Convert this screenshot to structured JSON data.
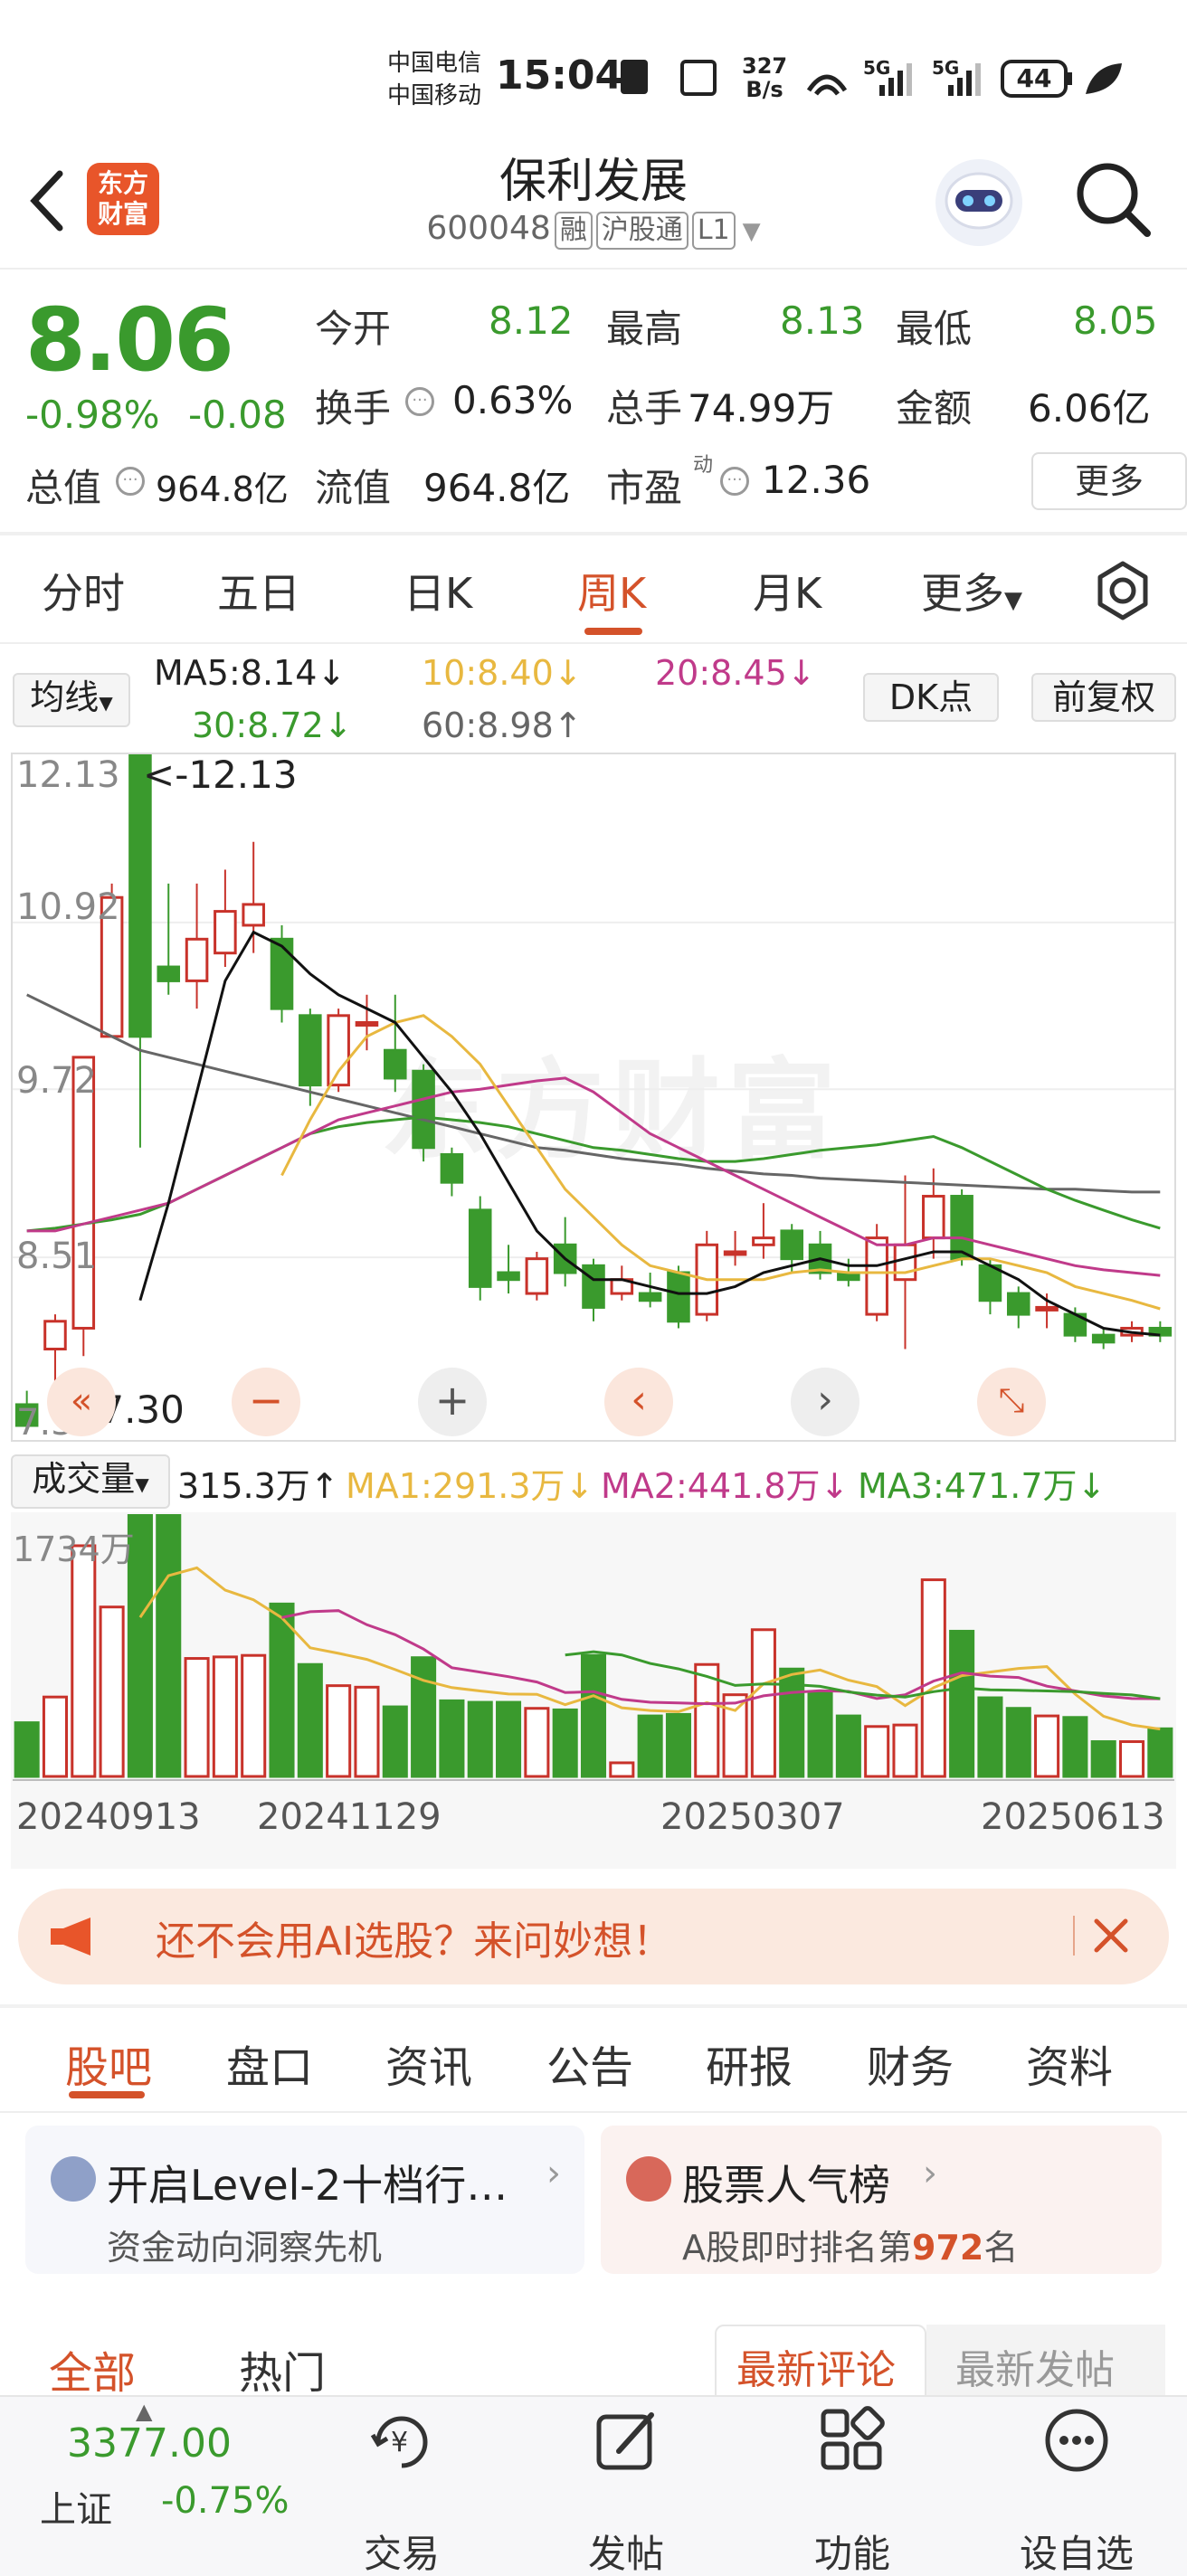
{
  "status_bar": {
    "carrier1": "中国电信",
    "carrier2": "中国移动",
    "time": "15:04",
    "speed_top": "327",
    "speed_bottom": "B/s",
    "battery": "44"
  },
  "header": {
    "back_icon": "chevron-left-icon",
    "logo_line1": "东方",
    "logo_line2": "财富",
    "title": "保利发展",
    "code": "600048",
    "tag1": "融",
    "tag2": "沪股通",
    "tag3": "L1",
    "search_icon": "search-icon"
  },
  "quote": {
    "price": "8.06",
    "change_pct": "-0.98%",
    "change": "-0.08",
    "open_label": "今开",
    "open": "8.12",
    "high_label": "最高",
    "high": "8.13",
    "low_label": "最低",
    "low": "8.05",
    "turnover_label": "换手",
    "turnover": "0.63%",
    "volume_label": "总手",
    "volume": "74.99万",
    "amount_label": "金额",
    "amount": "6.06亿",
    "mktcap_label": "总值",
    "mktcap": "964.8亿",
    "float_label": "流值",
    "float": "964.8亿",
    "pe_label": "市盈",
    "pe_sup": "动",
    "pe": "12.36",
    "more": "更多"
  },
  "period_tabs": [
    "分时",
    "五日",
    "日K",
    "周K",
    "月K",
    "更多"
  ],
  "active_period": "周K",
  "chart": {
    "ma_select": "均线",
    "ma5": "MA5:8.14↓",
    "ma10": "10:8.40↓",
    "ma20": "20:8.45↓",
    "ma30": "30:8.72↓",
    "ma60": "60:8.98↑",
    "dk_button": "DK点",
    "adjust_button": "前复权",
    "y_labels": [
      "12.13",
      "10.92",
      "9.72",
      "8.51",
      "7.30"
    ],
    "max_note": "<-12.13",
    "min_note": "<-7.30",
    "watermark": "东方财富",
    "colors": {
      "up": "#c8322a",
      "down": "#3a9a2d",
      "ma5": "#111111",
      "ma10": "#e8b840",
      "ma20": "#c03a8a",
      "ma30": "#3a9a2d",
      "ma60": "#666666"
    }
  },
  "volume": {
    "select": "成交量",
    "value": "315.3万↑",
    "ma1": "MA1:291.3万↓",
    "ma2": "MA2:441.8万↓",
    "ma3": "MA3:471.7万↓",
    "y_label": "1734万",
    "dates": [
      "20240913",
      "20241129",
      "20250307",
      "20250613"
    ]
  },
  "chart_data": {
    "type": "candlestick",
    "y_range": [
      7.3,
      12.13
    ],
    "period": "weekly",
    "candles": [
      {
        "o": 7.45,
        "c": 7.3,
        "h": 7.55,
        "l": 7.3
      },
      {
        "o": 7.85,
        "c": 8.05,
        "h": 8.1,
        "l": 7.35
      },
      {
        "o": 8.0,
        "c": 9.95,
        "h": 9.95,
        "l": 7.8
      },
      {
        "o": 10.1,
        "c": 11.1,
        "h": 11.2,
        "l": 10.1
      },
      {
        "o": 12.13,
        "c": 10.1,
        "h": 12.13,
        "l": 9.3
      },
      {
        "o": 10.6,
        "c": 10.5,
        "h": 11.2,
        "l": 10.4
      },
      {
        "o": 10.5,
        "c": 10.8,
        "h": 11.2,
        "l": 10.3
      },
      {
        "o": 10.7,
        "c": 11.0,
        "h": 11.3,
        "l": 10.6
      },
      {
        "o": 10.9,
        "c": 11.05,
        "h": 11.5,
        "l": 10.7
      },
      {
        "o": 10.8,
        "c": 10.3,
        "h": 10.9,
        "l": 10.2
      },
      {
        "o": 10.25,
        "c": 9.75,
        "h": 10.3,
        "l": 9.6
      },
      {
        "o": 9.75,
        "c": 10.25,
        "h": 10.3,
        "l": 9.7
      },
      {
        "o": 10.2,
        "c": 10.2,
        "h": 10.4,
        "l": 10.0
      },
      {
        "o": 10.0,
        "c": 9.8,
        "h": 10.4,
        "l": 9.7
      },
      {
        "o": 9.85,
        "c": 9.3,
        "h": 9.9,
        "l": 9.2
      },
      {
        "o": 9.25,
        "c": 9.05,
        "h": 9.3,
        "l": 8.95
      },
      {
        "o": 8.85,
        "c": 8.3,
        "h": 8.95,
        "l": 8.2
      },
      {
        "o": 8.4,
        "c": 8.35,
        "h": 8.6,
        "l": 8.25
      },
      {
        "o": 8.25,
        "c": 8.5,
        "h": 8.55,
        "l": 8.2
      },
      {
        "o": 8.6,
        "c": 8.4,
        "h": 8.8,
        "l": 8.3
      },
      {
        "o": 8.45,
        "c": 8.15,
        "h": 8.5,
        "l": 8.05
      },
      {
        "o": 8.25,
        "c": 8.35,
        "h": 8.45,
        "l": 8.2
      },
      {
        "o": 8.25,
        "c": 8.2,
        "h": 8.4,
        "l": 8.15
      },
      {
        "o": 8.4,
        "c": 8.05,
        "h": 8.45,
        "l": 8.0
      },
      {
        "o": 8.1,
        "c": 8.6,
        "h": 8.7,
        "l": 8.05
      },
      {
        "o": 8.55,
        "c": 8.55,
        "h": 8.7,
        "l": 8.45
      },
      {
        "o": 8.6,
        "c": 8.65,
        "h": 8.9,
        "l": 8.5
      },
      {
        "o": 8.7,
        "c": 8.5,
        "h": 8.75,
        "l": 8.4
      },
      {
        "o": 8.6,
        "c": 8.4,
        "h": 8.7,
        "l": 8.35
      },
      {
        "o": 8.4,
        "c": 8.35,
        "h": 8.5,
        "l": 8.3
      },
      {
        "o": 8.1,
        "c": 8.65,
        "h": 8.75,
        "l": 8.05
      },
      {
        "o": 8.35,
        "c": 8.6,
        "h": 9.1,
        "l": 7.85
      },
      {
        "o": 8.65,
        "c": 8.95,
        "h": 9.15,
        "l": 8.5
      },
      {
        "o": 8.95,
        "c": 8.5,
        "h": 9.0,
        "l": 8.45
      },
      {
        "o": 8.45,
        "c": 8.2,
        "h": 8.5,
        "l": 8.1
      },
      {
        "o": 8.25,
        "c": 8.1,
        "h": 8.3,
        "l": 8.0
      },
      {
        "o": 8.15,
        "c": 8.15,
        "h": 8.25,
        "l": 8.0
      },
      {
        "o": 8.1,
        "c": 7.95,
        "h": 8.15,
        "l": 7.9
      },
      {
        "o": 7.95,
        "c": 7.9,
        "h": 8.0,
        "l": 7.85
      },
      {
        "o": 7.95,
        "c": 8.0,
        "h": 8.05,
        "l": 7.9
      },
      {
        "o": 8.0,
        "c": 7.95,
        "h": 8.05,
        "l": 7.9
      }
    ],
    "ma5": [
      null,
      null,
      null,
      null,
      8.2,
      8.9,
      9.7,
      10.5,
      10.85,
      10.75,
      10.55,
      10.4,
      10.3,
      10.2,
      9.95,
      9.7,
      9.4,
      9.05,
      8.7,
      8.5,
      8.35,
      8.35,
      8.3,
      8.25,
      8.25,
      8.3,
      8.4,
      8.45,
      8.5,
      8.45,
      8.45,
      8.5,
      8.55,
      8.55,
      8.45,
      8.35,
      8.2,
      8.1,
      8.0,
      7.97,
      7.95
    ],
    "ma10": [
      null,
      null,
      null,
      null,
      null,
      null,
      null,
      null,
      null,
      9.1,
      9.5,
      9.85,
      10.1,
      10.2,
      10.25,
      10.1,
      9.9,
      9.6,
      9.3,
      9.0,
      8.8,
      8.6,
      8.45,
      8.4,
      8.35,
      8.35,
      8.35,
      8.4,
      8.42,
      8.4,
      8.4,
      8.4,
      8.45,
      8.5,
      8.5,
      8.45,
      8.4,
      8.3,
      8.25,
      8.2,
      8.14
    ],
    "ma20": [
      8.7,
      8.7,
      8.75,
      8.8,
      8.85,
      8.9,
      9.0,
      9.1,
      9.2,
      9.3,
      9.4,
      9.5,
      9.55,
      9.6,
      9.65,
      9.7,
      9.72,
      9.75,
      9.78,
      9.8,
      9.7,
      9.55,
      9.4,
      9.3,
      9.2,
      9.1,
      9.0,
      8.9,
      8.8,
      8.7,
      8.6,
      8.6,
      8.65,
      8.65,
      8.6,
      8.55,
      8.5,
      8.45,
      8.42,
      8.4,
      8.38
    ],
    "ma30": [
      8.7,
      8.72,
      8.75,
      8.78,
      8.82,
      8.9,
      9.0,
      9.1,
      9.2,
      9.3,
      9.4,
      9.45,
      9.48,
      9.5,
      9.52,
      9.5,
      9.48,
      9.45,
      9.4,
      9.35,
      9.3,
      9.28,
      9.25,
      9.22,
      9.2,
      9.2,
      9.22,
      9.25,
      9.28,
      9.3,
      9.32,
      9.35,
      9.38,
      9.3,
      9.2,
      9.1,
      9.0,
      8.92,
      8.85,
      8.78,
      8.72
    ],
    "ma60": [
      10.4,
      10.3,
      10.2,
      10.1,
      10.0,
      9.95,
      9.9,
      9.85,
      9.8,
      9.75,
      9.7,
      9.65,
      9.6,
      9.55,
      9.5,
      9.45,
      9.4,
      9.35,
      9.3,
      9.28,
      9.25,
      9.22,
      9.2,
      9.18,
      9.15,
      9.13,
      9.11,
      9.1,
      9.08,
      9.07,
      9.06,
      9.05,
      9.04,
      9.03,
      9.02,
      9.01,
      9.0,
      9.0,
      8.99,
      8.98,
      8.98
    ],
    "volume_ylim": [
      0,
      1734
    ],
    "volume": [
      355,
      525,
      1525,
      1120,
      1734,
      1734,
      780,
      790,
      800,
      1140,
      740,
      600,
      590,
      460,
      785,
      500,
      490,
      490,
      450,
      440,
      800,
      90,
      400,
      410,
      740,
      540,
      970,
      710,
      560,
      400,
      330,
      340,
      1300,
      960,
      520,
      450,
      400,
      390,
      230,
      230,
      315
    ]
  },
  "chart_controls": [
    "double-left-icon",
    "minus-icon",
    "plus-icon",
    "chevron-left-icon",
    "chevron-right-icon",
    "expand-icon"
  ],
  "banner": {
    "text": "还不会用AI选股？来问妙想！",
    "icon": "megaphone-icon"
  },
  "bottom_tabs": [
    "股吧",
    "盘口",
    "资讯",
    "公告",
    "研报",
    "财务",
    "资料"
  ],
  "active_bottom_tab": "股吧",
  "cards": {
    "left_title": "开启Level-2十档行…",
    "left_sub": "资金动向洞察先机",
    "right_title": "股票人气榜",
    "right_sub_prefix": "A股即时排名第",
    "right_rank": "972",
    "right_sub_suffix": "名"
  },
  "filter": {
    "all": "全部",
    "hot": "热门",
    "latest_comment": "最新评论",
    "latest_post": "最新发帖"
  },
  "bottom_nav": {
    "index_value": "3377.00",
    "index_name": "上证",
    "index_change": "-0.75%",
    "trade": "交易",
    "post": "发帖",
    "function": "功能",
    "watchlist": "设自选"
  }
}
